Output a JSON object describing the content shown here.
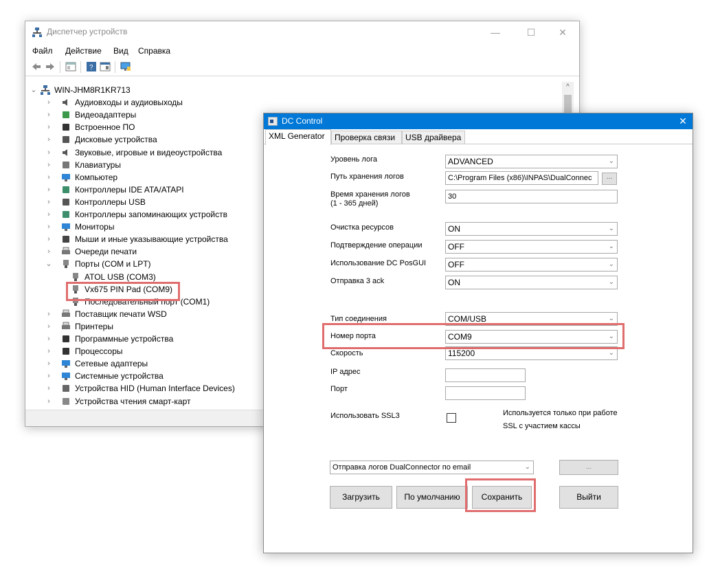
{
  "device_manager": {
    "title": "Диспетчер устройств",
    "window_controls": {
      "minimize": "—",
      "maximize": "☐",
      "close": "✕"
    },
    "menu": [
      "Файл",
      "Действие",
      "Вид",
      "Справка"
    ],
    "tree": {
      "root": "WIN-JHM8R1KR713",
      "items": [
        {
          "label": "Аудиовходы и аудиовыходы",
          "icon": "speaker-icon",
          "expanded": false
        },
        {
          "label": "Видеоадаптеры",
          "icon": "display-adapter-icon",
          "expanded": false
        },
        {
          "label": "Встроенное ПО",
          "icon": "firmware-icon",
          "expanded": false
        },
        {
          "label": "Дисковые устройства",
          "icon": "disk-icon",
          "expanded": false
        },
        {
          "label": "Звуковые, игровые и видеоустройства",
          "icon": "speaker-icon",
          "expanded": false
        },
        {
          "label": "Клавиатуры",
          "icon": "keyboard-icon",
          "expanded": false
        },
        {
          "label": "Компьютер",
          "icon": "monitor-icon",
          "expanded": false
        },
        {
          "label": "Контроллеры IDE ATA/ATAPI",
          "icon": "ide-icon",
          "expanded": false
        },
        {
          "label": "Контроллеры USB",
          "icon": "usb-icon",
          "expanded": false
        },
        {
          "label": "Контроллеры запоминающих устройств",
          "icon": "storage-icon",
          "expanded": false
        },
        {
          "label": "Мониторы",
          "icon": "monitor-icon",
          "expanded": false
        },
        {
          "label": "Мыши и иные указывающие устройства",
          "icon": "mouse-icon",
          "expanded": false
        },
        {
          "label": "Очереди печати",
          "icon": "printer-icon",
          "expanded": false
        },
        {
          "label": "Порты (COM и LPT)",
          "icon": "port-icon",
          "expanded": true
        },
        {
          "label": "ATOL USB (COM3)",
          "icon": "port-icon",
          "child": true
        },
        {
          "label": "Vx675 PIN Pad (COM9)",
          "icon": "port-icon",
          "child": true,
          "highlighted": true
        },
        {
          "label": "Последовательный порт (COM1)",
          "icon": "port-icon",
          "child": true
        },
        {
          "label": "Поставщик печати WSD",
          "icon": "printer-icon",
          "expanded": false
        },
        {
          "label": "Принтеры",
          "icon": "printer-icon",
          "expanded": false
        },
        {
          "label": "Программные устройства",
          "icon": "software-device-icon",
          "expanded": false
        },
        {
          "label": "Процессоры",
          "icon": "cpu-icon",
          "expanded": false
        },
        {
          "label": "Сетевые адаптеры",
          "icon": "network-icon",
          "expanded": false
        },
        {
          "label": "Системные устройства",
          "icon": "system-device-icon",
          "expanded": false
        },
        {
          "label": "Устройства HID (Human Interface Devices)",
          "icon": "hid-icon",
          "expanded": false
        },
        {
          "label": "Устройства чтения смарт-карт",
          "icon": "smartcard-icon",
          "expanded": false
        }
      ]
    }
  },
  "dc_control": {
    "title": "DC Control",
    "close": "✕",
    "tabs": [
      "XML Generator",
      "Проверка связи",
      "USB драйвера"
    ],
    "fields": {
      "log_level": {
        "label": "Уровень лога",
        "value": "ADVANCED"
      },
      "log_path": {
        "label": "Путь хранения логов",
        "value": "C:\\Program Files (x86)\\INPAS\\DualConnec",
        "browse": "..."
      },
      "log_days": {
        "label_line1": "Время хранения логов",
        "label_line2": "(1 - 365 дней)",
        "value": "30"
      },
      "cleanup": {
        "label": "Очистка ресурсов",
        "value": "ON"
      },
      "confirm_op": {
        "label": "Подтверждение операции",
        "value": "OFF"
      },
      "posgui": {
        "label": "Использование DC PosGUI",
        "value": "OFF"
      },
      "ack3": {
        "label": "Отправка 3 ack",
        "value": "ON"
      },
      "conn_type": {
        "label": "Тип соединения",
        "value": "COM/USB"
      },
      "port_number": {
        "label": "Номер порта",
        "value": "COM9",
        "highlighted": true
      },
      "speed": {
        "label": "Скорость",
        "value": "115200"
      },
      "ip": {
        "label": "IP адрес",
        "value": ""
      },
      "port": {
        "label": "Порт",
        "value": ""
      },
      "ssl3": {
        "label": "Использовать SSL3",
        "checked": false,
        "note_line1": "Используется только при работе",
        "note_line2": "SSL с участием кассы"
      }
    },
    "email_logs": {
      "value": "Отправка логов DualConnector по email",
      "browse": "..."
    },
    "buttons": {
      "load": "Загрузить",
      "default": "По умолчанию",
      "save": "Сохранить",
      "exit": "Выйти"
    }
  },
  "colors": {
    "highlight": "#e06d6d",
    "titlebar": "#0078d7"
  }
}
